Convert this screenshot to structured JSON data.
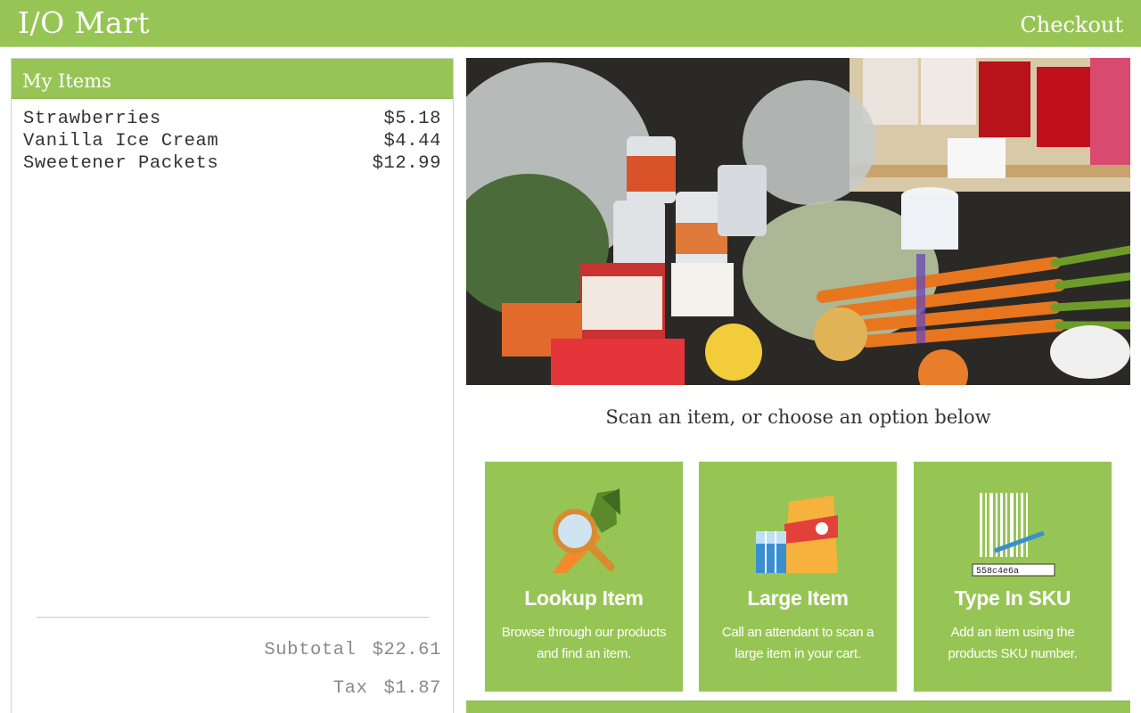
{
  "header": {
    "brand": "I/O Mart",
    "checkout_label": "Checkout"
  },
  "cart": {
    "title": "My Items",
    "items": [
      {
        "name": "Strawberries",
        "price": "$5.18"
      },
      {
        "name": "Vanilla Ice Cream",
        "price": "$4.44"
      },
      {
        "name": "Sweetener Packets",
        "price": "$12.99"
      }
    ],
    "subtotal_label": "Subtotal",
    "subtotal_value": "$22.61",
    "tax_label": "Tax",
    "tax_value": "$1.87"
  },
  "main": {
    "prompt": "Scan an item, or choose an option below",
    "options": [
      {
        "title": "Lookup Item",
        "description": "Browse through our products and find an item.",
        "icon": "carrot-magnifier-icon"
      },
      {
        "title": "Large Item",
        "description": "Call an attendant to scan a large item in your cart.",
        "icon": "dog-food-bag-icon"
      },
      {
        "title": "Type In SKU",
        "description": "Add an item using the products SKU number.",
        "icon": "barcode-icon",
        "sku_sample": "558c4e6a"
      }
    ]
  },
  "colors": {
    "brand_green": "#97c555",
    "text_dark": "#333333",
    "totals_grey": "#8a8a8a"
  }
}
